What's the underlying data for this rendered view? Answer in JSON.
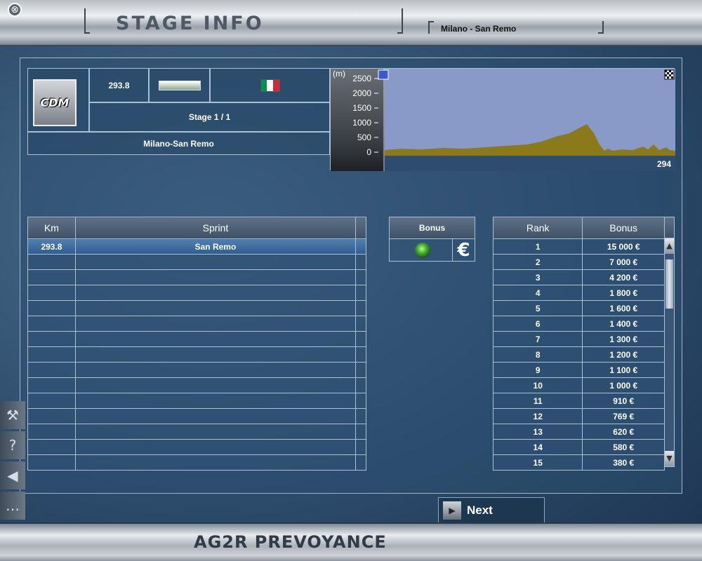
{
  "window": {
    "title": "STAGE INFO",
    "stage_name": "Milano - San Remo",
    "close_glyph": "⊗"
  },
  "stage": {
    "distance": "293.8",
    "stage_label": "Stage 1 / 1",
    "route": "Milano-San Remo",
    "logo_text": "CDM",
    "flag_colors": [
      "#009246",
      "#ffffff",
      "#ce2b37"
    ]
  },
  "profile": {
    "unit_label": "(m)",
    "y_ticks": [
      "2500",
      "2000",
      "1500",
      "1000",
      "500",
      "0"
    ],
    "end_km": "294",
    "fill_color": "#8a7a1c",
    "sky_color": "#8a9ac8"
  },
  "sprint_table": {
    "headers": {
      "km": "Km",
      "sprint": "Sprint"
    },
    "rows": [
      {
        "km": "293.8",
        "sprint": "San Remo"
      },
      {
        "km": "",
        "sprint": ""
      },
      {
        "km": "",
        "sprint": ""
      },
      {
        "km": "",
        "sprint": ""
      },
      {
        "km": "",
        "sprint": ""
      },
      {
        "km": "",
        "sprint": ""
      },
      {
        "km": "",
        "sprint": ""
      },
      {
        "km": "",
        "sprint": ""
      },
      {
        "km": "",
        "sprint": ""
      },
      {
        "km": "",
        "sprint": ""
      },
      {
        "km": "",
        "sprint": ""
      },
      {
        "km": "",
        "sprint": ""
      },
      {
        "km": "",
        "sprint": ""
      },
      {
        "km": "",
        "sprint": ""
      },
      {
        "km": "",
        "sprint": ""
      }
    ]
  },
  "bonus_toggle": {
    "header": "Bonus",
    "euro_glyph": "€"
  },
  "rank_table": {
    "headers": {
      "rank": "Rank",
      "bonus": "Bonus"
    },
    "rows": [
      {
        "rank": "1",
        "bonus": "15 000 €"
      },
      {
        "rank": "2",
        "bonus": "7 000 €"
      },
      {
        "rank": "3",
        "bonus": "4 200 €"
      },
      {
        "rank": "4",
        "bonus": "1 800 €"
      },
      {
        "rank": "5",
        "bonus": "1 600 €"
      },
      {
        "rank": "6",
        "bonus": "1 400 €"
      },
      {
        "rank": "7",
        "bonus": "1 300 €"
      },
      {
        "rank": "8",
        "bonus": "1 200 €"
      },
      {
        "rank": "9",
        "bonus": "1 100 €"
      },
      {
        "rank": "10",
        "bonus": "1 000 €"
      },
      {
        "rank": "11",
        "bonus": "910 €"
      },
      {
        "rank": "12",
        "bonus": "769 €"
      },
      {
        "rank": "13",
        "bonus": "620 €"
      },
      {
        "rank": "14",
        "bonus": "580 €"
      },
      {
        "rank": "15",
        "bonus": "380 €"
      }
    ]
  },
  "side_tools": [
    {
      "icon": "tools-icon",
      "glyph": "⚒"
    },
    {
      "icon": "help-icon",
      "glyph": "?"
    },
    {
      "icon": "sound-icon",
      "glyph": "◀"
    },
    {
      "icon": "chat-icon",
      "glyph": "…"
    }
  ],
  "footer": {
    "team_name": "AG2R PREVOYANCE",
    "next_label": "Next",
    "next_glyph": "▶"
  }
}
